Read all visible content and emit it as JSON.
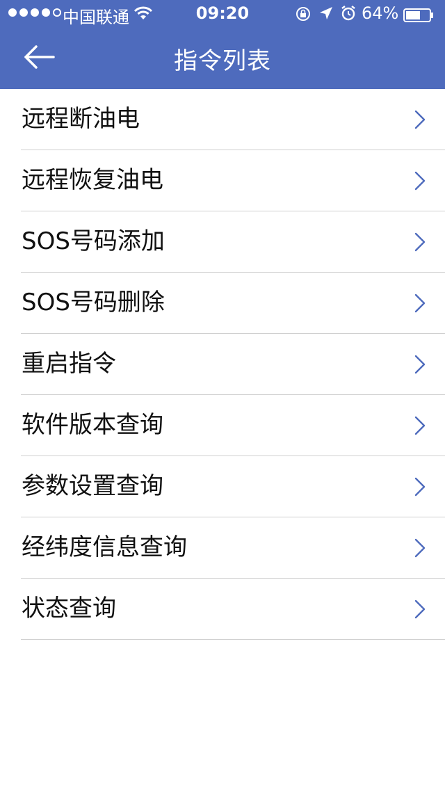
{
  "status_bar": {
    "carrier": "中国联通",
    "time": "09:20",
    "battery_percent": "64%",
    "battery_level": 0.64,
    "signal_bars_filled": 4,
    "signal_bars_total": 5
  },
  "header": {
    "title": "指令列表",
    "back_icon": "arrow-left-icon",
    "background_color": "#4e6bbd"
  },
  "commands": [
    {
      "label": "远程断油电"
    },
    {
      "label": "远程恢复油电"
    },
    {
      "label": "SOS号码添加"
    },
    {
      "label": "SOS号码删除"
    },
    {
      "label": "重启指令"
    },
    {
      "label": "软件版本查询"
    },
    {
      "label": "参数设置查询"
    },
    {
      "label": "经纬度信息查询"
    },
    {
      "label": "状态查询"
    }
  ]
}
